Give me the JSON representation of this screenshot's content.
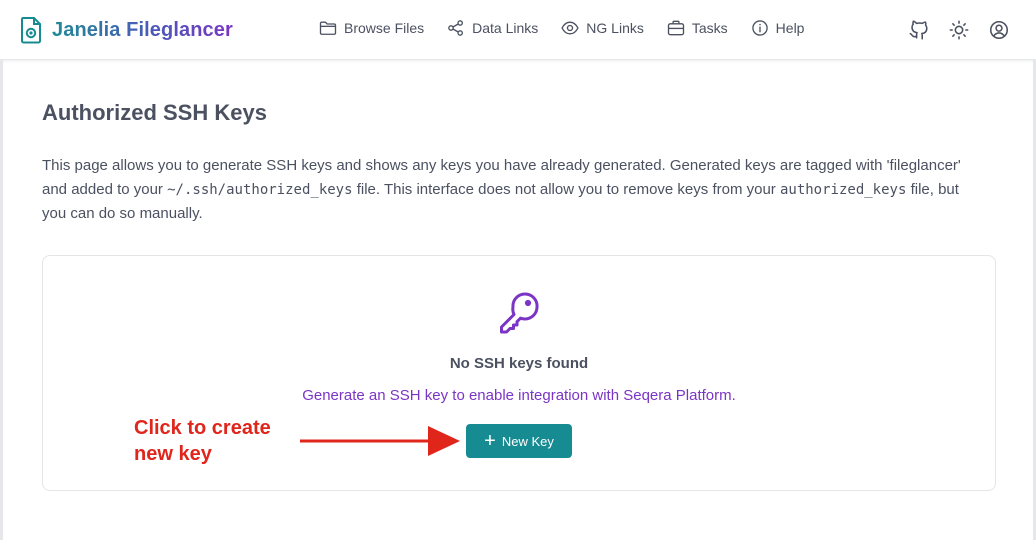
{
  "app": {
    "title": "Janelia Fileglancer"
  },
  "nav": [
    {
      "label": "Browse Files",
      "icon": "folder-icon"
    },
    {
      "label": "Data Links",
      "icon": "share-icon"
    },
    {
      "label": "NG Links",
      "icon": "eye-icon"
    },
    {
      "label": "Tasks",
      "icon": "briefcase-icon"
    },
    {
      "label": "Help",
      "icon": "info-icon"
    }
  ],
  "header_actions": [
    "github-icon",
    "theme-toggle-icon",
    "user-account-icon"
  ],
  "page": {
    "title": "Authorized SSH Keys",
    "desc_1": "This page allows you to generate SSH keys and shows any keys you have already generated. Generated keys are tagged with 'fileglancer' and added to your ",
    "desc_code_1": "~/.ssh/authorized_keys",
    "desc_2": " file. This interface does not allow you to remove keys from your ",
    "desc_code_2": "authorized_keys",
    "desc_3": " file, but you can do so manually."
  },
  "empty_state": {
    "title": "No SSH keys found",
    "subtitle": "Generate an SSH key to enable integration with Seqera Platform.",
    "button_label": "New Key"
  },
  "annotation": {
    "text_line1": "Click to create",
    "text_line2": "new key"
  },
  "colors": {
    "accent": "#168b92",
    "brand_purple": "#7b35c4",
    "annotation_red": "#e0251b"
  }
}
